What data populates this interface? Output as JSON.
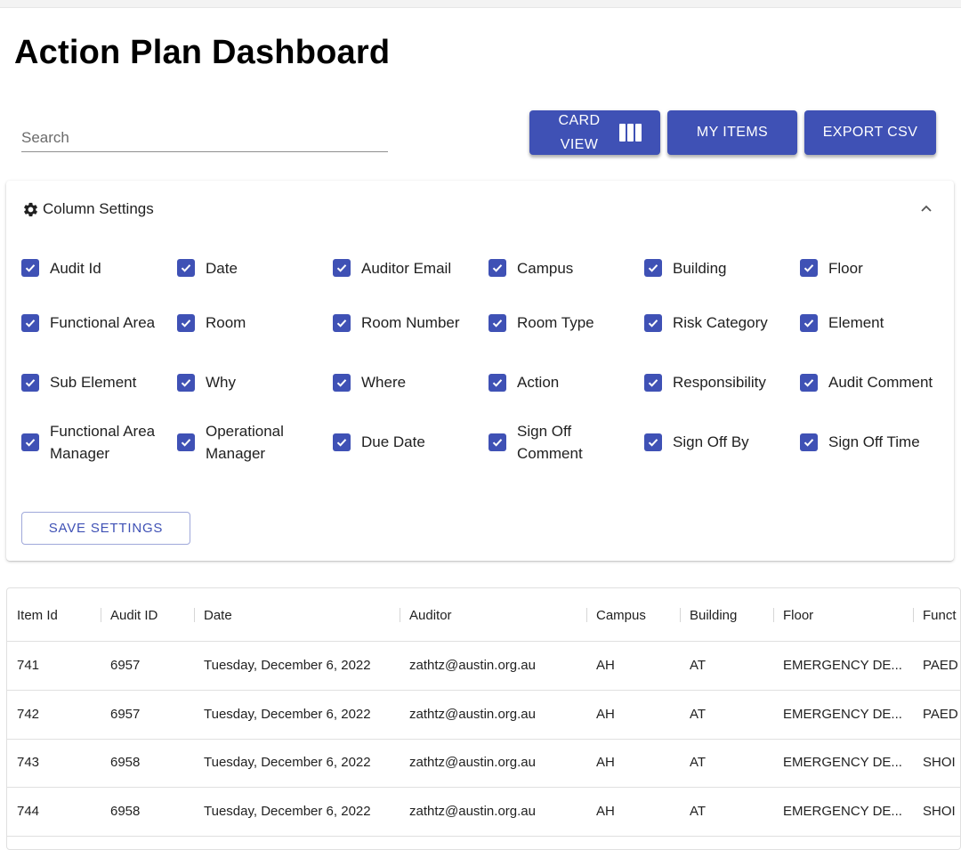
{
  "page": {
    "title": "Action Plan Dashboard"
  },
  "search": {
    "placeholder": "Search",
    "value": ""
  },
  "toolbar": {
    "card_view_label": "CARD VIEW",
    "card_view_icon": "view-column-icon",
    "my_items_label": "MY ITEMS",
    "export_csv_label": "EXPORT CSV"
  },
  "column_settings": {
    "title": "Column Settings",
    "icon": "gear-icon",
    "collapse_icon": "chevron-up-icon",
    "options": [
      {
        "label": "Audit Id",
        "checked": true
      },
      {
        "label": "Date",
        "checked": true
      },
      {
        "label": "Auditor Email",
        "checked": true
      },
      {
        "label": "Campus",
        "checked": true
      },
      {
        "label": "Building",
        "checked": true
      },
      {
        "label": "Floor",
        "checked": true
      },
      {
        "label": "Functional Area",
        "checked": true
      },
      {
        "label": "Room",
        "checked": true
      },
      {
        "label": "Room Number",
        "checked": true
      },
      {
        "label": "Room Type",
        "checked": true
      },
      {
        "label": "Risk Category",
        "checked": true
      },
      {
        "label": "Element",
        "checked": true
      },
      {
        "label": "Sub Element",
        "checked": true
      },
      {
        "label": "Why",
        "checked": true
      },
      {
        "label": "Where",
        "checked": true
      },
      {
        "label": "Action",
        "checked": true
      },
      {
        "label": "Responsibility",
        "checked": true
      },
      {
        "label": "Audit Comment",
        "checked": true
      },
      {
        "label": "Functional Area Manager",
        "checked": true
      },
      {
        "label": "Operational Manager",
        "checked": true
      },
      {
        "label": "Due Date",
        "checked": true
      },
      {
        "label": "Sign Off Comment",
        "checked": true
      },
      {
        "label": "Sign Off By",
        "checked": true
      },
      {
        "label": "Sign Off Time",
        "checked": true
      }
    ],
    "save_label": "SAVE SETTINGS"
  },
  "table": {
    "columns": [
      "Item Id",
      "Audit ID",
      "Date",
      "Auditor",
      "Campus",
      "Building",
      "Floor",
      "Funct"
    ],
    "rows": [
      [
        "741",
        "6957",
        "Tuesday, December 6, 2022",
        "zathtz@austin.org.au",
        "AH",
        "AT",
        "EMERGENCY DE...",
        "PAED"
      ],
      [
        "742",
        "6957",
        "Tuesday, December 6, 2022",
        "zathtz@austin.org.au",
        "AH",
        "AT",
        "EMERGENCY DE...",
        "PAED"
      ],
      [
        "743",
        "6958",
        "Tuesday, December 6, 2022",
        "zathtz@austin.org.au",
        "AH",
        "AT",
        "EMERGENCY DE...",
        "SHOI"
      ],
      [
        "744",
        "6958",
        "Tuesday, December 6, 2022",
        "zathtz@austin.org.au",
        "AH",
        "AT",
        "EMERGENCY DE...",
        "SHOI"
      ]
    ]
  },
  "colors": {
    "primary": "#3f51b5",
    "title": "#000000",
    "text": "#212121"
  }
}
